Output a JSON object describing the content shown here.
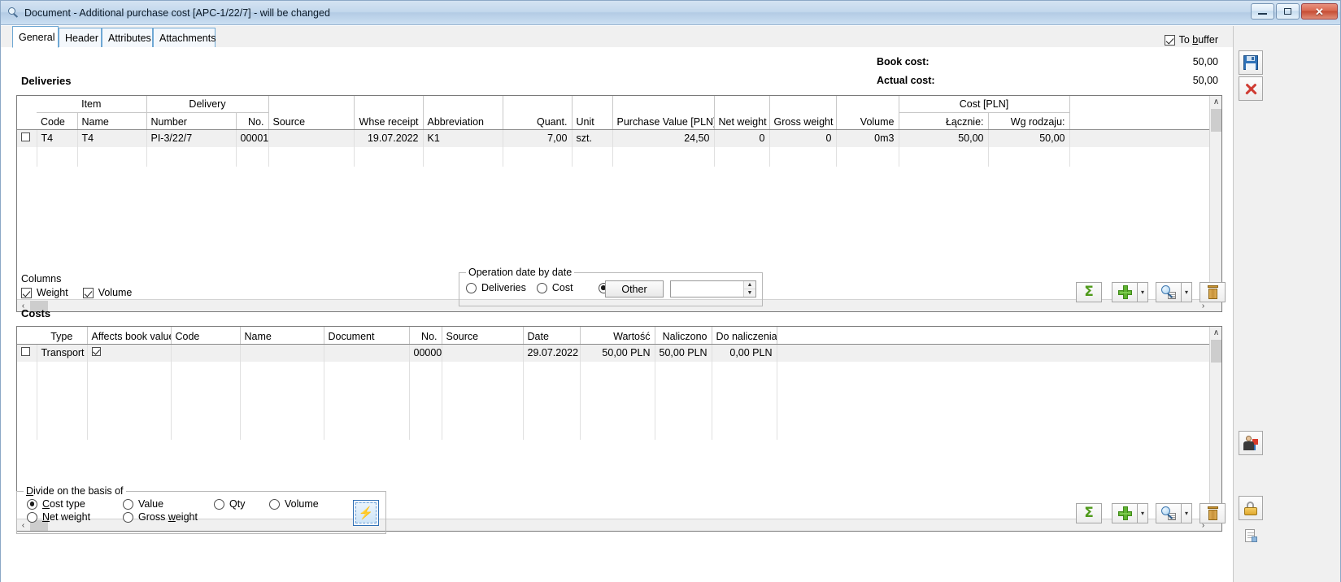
{
  "window": {
    "title": "Document - Additional purchase cost [APC-1/22/7]  - will be changed",
    "title_icon": "magnifier-icon",
    "minimize_label": "–",
    "maximize_label": "▫",
    "close_label": "✕"
  },
  "tabs": [
    {
      "label": "General",
      "active": true
    },
    {
      "label": "Header",
      "active": false
    },
    {
      "label": "Attributes",
      "active": false
    },
    {
      "label": "Attachments",
      "active": false
    }
  ],
  "to_buffer": {
    "label": "To buffer",
    "checked": true,
    "accesskey": "b"
  },
  "summary": {
    "book_cost_label": "Book cost:",
    "book_cost_value": "50,00",
    "actual_cost_label": "Actual cost:",
    "actual_cost_value": "50,00"
  },
  "deliveries": {
    "title": "Deliveries",
    "group_headers": [
      {
        "label": "",
        "span": 1
      },
      {
        "label": "Item",
        "span": 2
      },
      {
        "label": "Delivery",
        "span": 2
      },
      {
        "label": "Source",
        "span": 1
      },
      {
        "label": "Whse receipt",
        "span": 1
      },
      {
        "label": "Abbreviation",
        "span": 1
      },
      {
        "label": "Quant.",
        "span": 1
      },
      {
        "label": "Unit",
        "span": 1
      },
      {
        "label": "Purchase Value [PLN]",
        "span": 1
      },
      {
        "label": "Net weight",
        "span": 1
      },
      {
        "label": "Gross weight",
        "span": 1
      },
      {
        "label": "Volume",
        "span": 1
      },
      {
        "label": "Cost [PLN]",
        "span": 2
      },
      {
        "label": "",
        "span": 1
      }
    ],
    "columns": [
      {
        "label": "",
        "align": "left"
      },
      {
        "label": "Code",
        "align": "left"
      },
      {
        "label": "Name",
        "align": "left"
      },
      {
        "label": "Number",
        "align": "left"
      },
      {
        "label": "No.",
        "align": "right"
      },
      {
        "label": "Source",
        "align": "left"
      },
      {
        "label": "Whse receipt",
        "align": "right"
      },
      {
        "label": "Abbreviation",
        "align": "left"
      },
      {
        "label": "Quant.",
        "align": "right"
      },
      {
        "label": "Unit",
        "align": "left"
      },
      {
        "label": "Purchase Value [PLN]",
        "align": "right"
      },
      {
        "label": "Net weight",
        "align": "right"
      },
      {
        "label": "Gross weight",
        "align": "right"
      },
      {
        "label": "Volume",
        "align": "right"
      },
      {
        "label": "Łącznie:",
        "align": "right"
      },
      {
        "label": "Wg rodzaju:",
        "align": "right"
      },
      {
        "label": "",
        "align": "left"
      }
    ],
    "rows": [
      {
        "selected": false,
        "code": "T4",
        "name": "T4",
        "delivery_number": "PI-3/22/7",
        "delivery_no": "00001",
        "source": "",
        "whse_receipt": "19.07.2022",
        "abbreviation": "K1",
        "quantity": "7,00",
        "unit": "szt.",
        "purchase_value": "24,50",
        "net_weight": "0",
        "gross_weight": "0",
        "volume": "0m3",
        "cost_total": "50,00",
        "cost_by_type": "50,00",
        "tail": ""
      }
    ]
  },
  "columns_box": {
    "title": "Columns",
    "weight": {
      "label": "Weight",
      "checked": true
    },
    "volume": {
      "label": "Volume",
      "checked": true
    }
  },
  "operation_date": {
    "title": "Operation date by date",
    "options": [
      {
        "label": "Deliveries",
        "selected": false
      },
      {
        "label": "Cost",
        "selected": false
      },
      {
        "label": "",
        "selected": true
      }
    ],
    "other_button": "Other",
    "date_value": "",
    "spin_up": "▲",
    "spin_down": "▼"
  },
  "costs": {
    "title": "Costs",
    "columns": [
      {
        "label": "",
        "align": "left"
      },
      {
        "label": "Type",
        "align": "left"
      },
      {
        "label": "Affects book value",
        "align": "left"
      },
      {
        "label": "Code",
        "align": "left"
      },
      {
        "label": "Name",
        "align": "left"
      },
      {
        "label": "Document",
        "align": "left"
      },
      {
        "label": "No.",
        "align": "right"
      },
      {
        "label": "Source",
        "align": "left"
      },
      {
        "label": "Date",
        "align": "left"
      },
      {
        "label": "Wartość",
        "align": "right"
      },
      {
        "label": "Naliczono",
        "align": "right"
      },
      {
        "label": "Do naliczenia",
        "align": "right"
      },
      {
        "label": "",
        "align": "left"
      }
    ],
    "rows": [
      {
        "selected": false,
        "type": "Transport",
        "affects_book_value": true,
        "code": "",
        "name": "",
        "document": "",
        "no": "00000",
        "source": "",
        "date": "29.07.2022",
        "wartosc": "50,00 PLN",
        "naliczono": "50,00 PLN",
        "do_naliczenia": "0,00 PLN",
        "tail": ""
      }
    ]
  },
  "divide_box": {
    "title": "Divide on the basis of",
    "accesskey": "D",
    "options": [
      {
        "label": "Cost type",
        "selected": true,
        "accesskey": "C"
      },
      {
        "label": "Value",
        "selected": false
      },
      {
        "label": "Qty",
        "selected": false
      },
      {
        "label": "Volume",
        "selected": false
      },
      {
        "label": "Net weight",
        "selected": false,
        "accesskey": "N"
      },
      {
        "label": "Gross weight",
        "selected": false,
        "accesskey": "w"
      }
    ],
    "action_button": {
      "name": "recalculate-bolt-button",
      "glyph": "⚡"
    }
  },
  "deliveries_toolbar": [
    {
      "name": "sum-button",
      "icon": "sigma-icon",
      "glyph": "Σ",
      "has_dropdown": false
    },
    {
      "name": "add-button",
      "icon": "plus-icon",
      "has_dropdown": true
    },
    {
      "name": "preview-button",
      "icon": "magnifier-doc-icon",
      "has_dropdown": true
    },
    {
      "name": "delete-button",
      "icon": "trash-icon",
      "has_dropdown": false
    }
  ],
  "costs_toolbar": [
    {
      "name": "sum-button",
      "icon": "sigma-icon",
      "glyph": "Σ",
      "has_dropdown": false
    },
    {
      "name": "add-button",
      "icon": "plus-icon",
      "has_dropdown": true
    },
    {
      "name": "preview-button",
      "icon": "magnifier-doc-icon",
      "has_dropdown": true
    },
    {
      "name": "delete-button",
      "icon": "trash-icon",
      "has_dropdown": false
    }
  ],
  "rail_buttons": [
    {
      "name": "save-button",
      "icon": "save-disk-icon"
    },
    {
      "name": "cancel-button",
      "icon": "red-x-icon"
    },
    {
      "name": "contractor-button",
      "icon": "person-cards-icon"
    },
    {
      "name": "unlock-button",
      "icon": "open-padlock-icon"
    },
    {
      "name": "document-lock-button",
      "icon": "document-lock-icon"
    }
  ],
  "scrollbars": {
    "up": "∧",
    "down": "∨",
    "left": "‹",
    "right": "›"
  },
  "colors": {
    "accent": "#2f72b8",
    "title_gradient_top": "#d4e3f2",
    "title_gradient_bottom": "#b3cbe4",
    "row_selected_bg": "#f0f0f0",
    "green": "#5fb230",
    "close_red": "#c64c33"
  }
}
